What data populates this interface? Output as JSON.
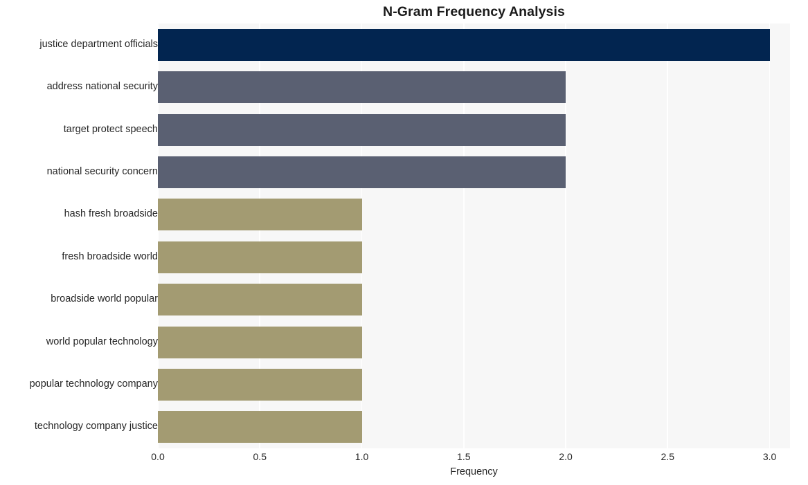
{
  "chart_data": {
    "type": "bar",
    "orientation": "horizontal",
    "title": "N-Gram Frequency Analysis",
    "xlabel": "Frequency",
    "ylabel": "",
    "categories": [
      "justice department officials",
      "address national security",
      "target protect speech",
      "national security concern",
      "hash fresh broadside",
      "fresh broadside world",
      "broadside world popular",
      "world popular technology",
      "popular technology company",
      "technology company justice"
    ],
    "values": [
      3,
      2,
      2,
      2,
      1,
      1,
      1,
      1,
      1,
      1
    ],
    "bar_colors": [
      "#022550",
      "#5a6072",
      "#5a6072",
      "#5a6072",
      "#a39b72",
      "#a39b72",
      "#a39b72",
      "#a39b72",
      "#a39b72",
      "#a39b72"
    ],
    "xlim": [
      0,
      3.1
    ],
    "xticks": [
      0.0,
      0.5,
      1.0,
      1.5,
      2.0,
      2.5,
      3.0
    ],
    "xtick_labels": [
      "0.0",
      "0.5",
      "1.0",
      "1.5",
      "2.0",
      "2.5",
      "3.0"
    ],
    "grid": "vertical",
    "legend": "none",
    "style": {
      "figure_background": "#ffffff",
      "plot_background": "#f7f7f7",
      "gridline_color": "#ffffff",
      "text_color": "#262626"
    }
  }
}
